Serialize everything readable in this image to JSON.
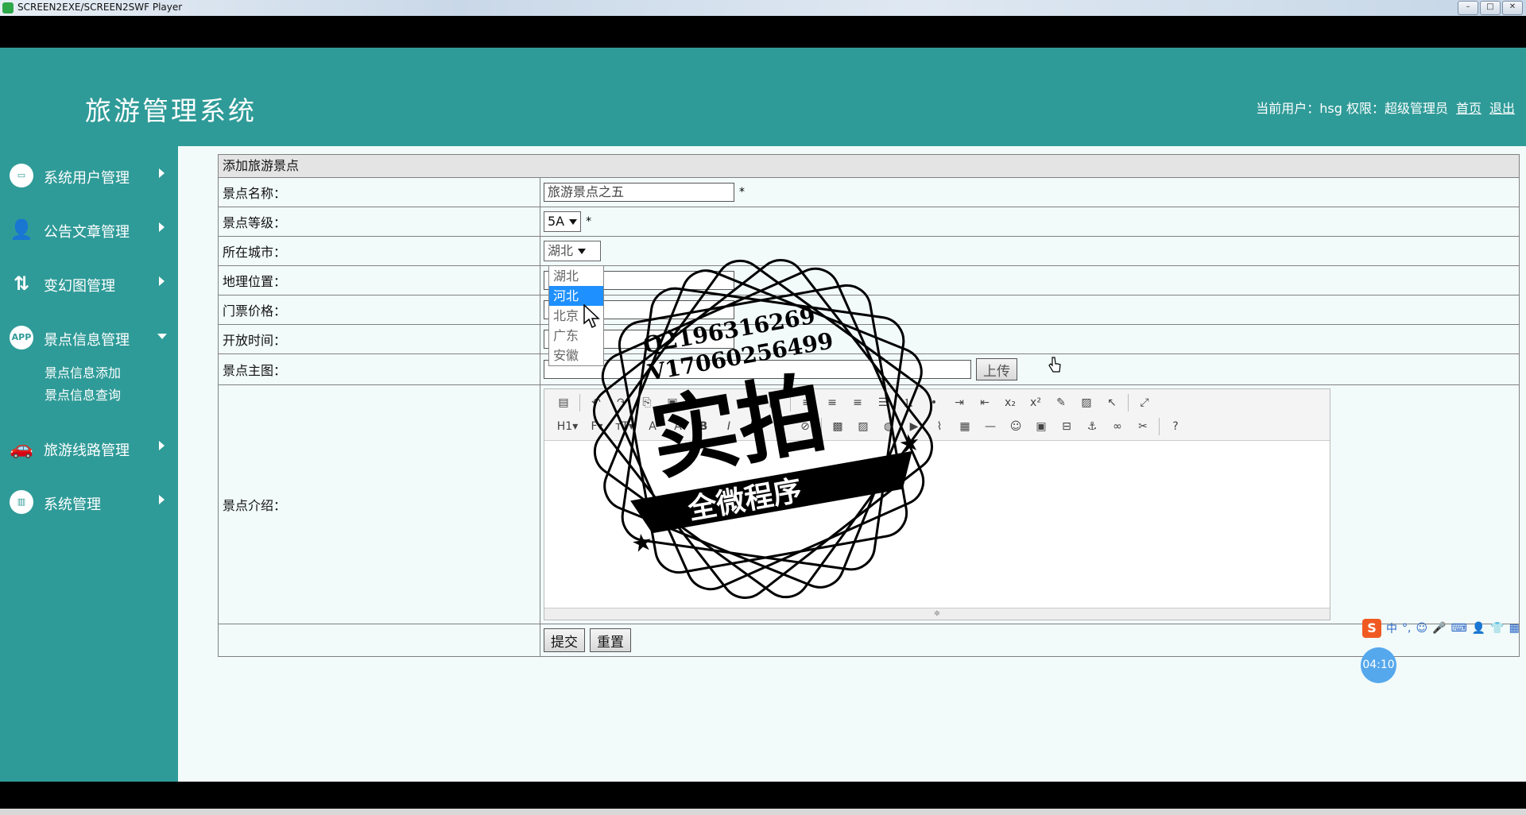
{
  "window": {
    "title": "SCREEN2EXE/SCREEN2SWF Player",
    "btn_min": "–",
    "btn_max": "□",
    "btn_close": "✕"
  },
  "header": {
    "title": "旅游管理系统",
    "user_text": "当前用户：hsg  权限：超级管理员",
    "home_link": "首页",
    "logout_link": "退出"
  },
  "sidebar": {
    "items": [
      {
        "label": "系统用户管理",
        "icon": "monitor-icon"
      },
      {
        "label": "公告文章管理",
        "icon": "user-settings-icon"
      },
      {
        "label": "变幻图管理",
        "icon": "transform-icon"
      },
      {
        "label": "景点信息管理",
        "icon": "app-icon",
        "icon_text": "APP"
      },
      {
        "label": "旅游线路管理",
        "icon": "car-icon"
      },
      {
        "label": "系统管理",
        "icon": "chart-icon"
      }
    ],
    "sub_items": [
      "景点信息添加",
      "景点信息查询"
    ]
  },
  "form": {
    "heading": "添加旅游景点",
    "fields": {
      "name_label": "景点名称：",
      "name_value": "旅游景点之五",
      "level_label": "景点等级：",
      "level_value": "5A",
      "city_label": "所在城市：",
      "city_value": "湖北",
      "location_label": "地理位置：",
      "price_label": "门票价格：",
      "hours_label": "开放时间：",
      "image_label": "景点主图：",
      "upload_button": "上传",
      "intro_label": "景点介绍："
    },
    "required_mark": "*",
    "city_options": [
      "湖北",
      "河北",
      "北京",
      "广东",
      "安徽"
    ],
    "city_highlighted": "河北",
    "submit": "提交",
    "reset": "重置"
  },
  "watermark": {
    "line1": "Q2196316269",
    "line2": "V17060256499",
    "big": "实拍",
    "banner": "全微程序"
  },
  "ime": {
    "logo": "S",
    "lang": "中"
  },
  "timer": "04:10",
  "colors": {
    "teal": "#2f9b98",
    "content_bg": "#f2fbfa",
    "highlight": "#1e90ff"
  }
}
